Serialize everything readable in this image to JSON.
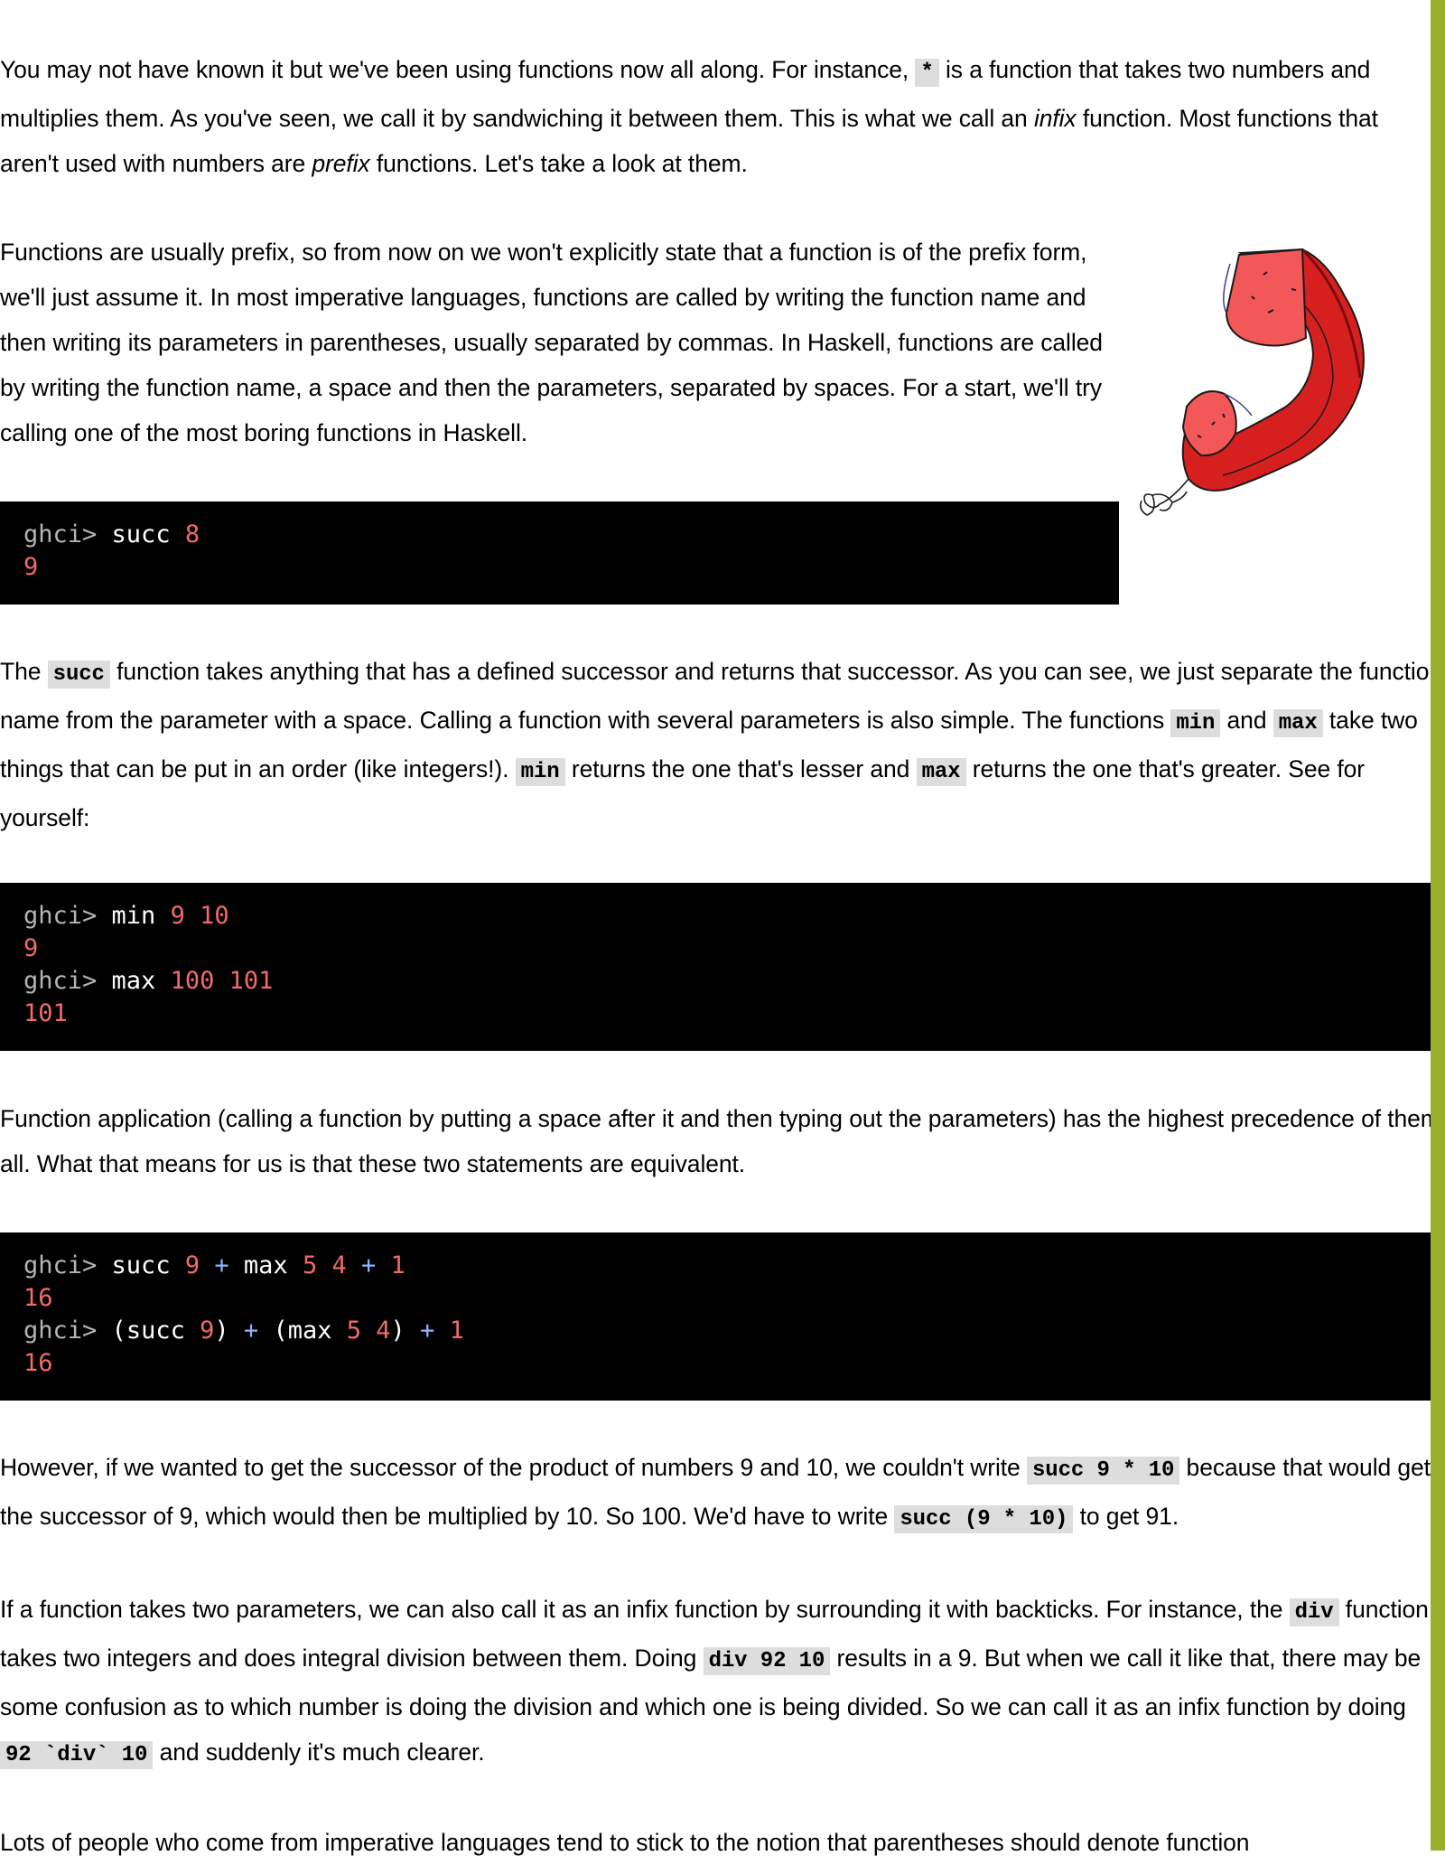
{
  "p1": {
    "t1": "You may not have known it but we've been using functions now all along. For instance, ",
    "c1": "*",
    "t2": " is a function that takes two numbers and multiplies them. As you've seen, we call it by sandwiching it between them. This is what we call an ",
    "e1": "infix",
    "t3": " function. Most functions that aren't used with numbers are ",
    "e2": "prefix",
    "t4": " functions. Let's take a look at them."
  },
  "p2": {
    "text": "Functions are usually prefix, so from now on we won't explicitly state that a function is of the prefix form, we'll just assume it. In most imperative languages, functions are called by writing the function name and then writing its parameters in parentheses, usually separated by commas. In Haskell, functions are called by writing the function name, a space and then the parameters, separated by spaces. For a start, we'll try calling one of the most boring functions in Haskell."
  },
  "code1": {
    "prompt": "ghci>",
    "fn": "succ",
    "arg": "8",
    "output": "9"
  },
  "p3": {
    "t1": "The ",
    "c1": "succ",
    "t2": " function takes anything that has a defined successor and returns that successor. As you can see, we just separate the function name from the parameter with a space. Calling a function with several parameters is also simple. The functions ",
    "c2": "min",
    "t3": " and ",
    "c3": "max",
    "t4": " take two things that can be put in an order (like integers!). ",
    "c4": "min",
    "t5": " returns the one that's lesser and ",
    "c5": "max",
    "t6": " returns the one that's greater. See for yourself:"
  },
  "code2": {
    "prompt": "ghci>",
    "l1_fn": "min",
    "l1_a": "9",
    "l1_b": "10",
    "l1_out": "9",
    "l2_fn": "max",
    "l2_a": "100",
    "l2_b": "101",
    "l2_out": "101"
  },
  "p4": {
    "text": "Function application (calling a function by putting a space after it and then typing out the parameters) has the highest precedence of them all. What that means for us is that these two statements are equivalent."
  },
  "code3": {
    "prompt": "ghci>",
    "succ": "succ",
    "max": "max",
    "plus": "+",
    "lp": "(",
    "rp": ")",
    "n9": "9",
    "n5": "5",
    "n4": "4",
    "n1": "1",
    "out": "16"
  },
  "p5": {
    "t1": "However, if we wanted to get the successor of the product of numbers 9 and 10, we couldn't write ",
    "c1": "succ 9 * 10",
    "t2": " because that would get the successor of 9, which would then be multiplied by 10. So 100. We'd have to write ",
    "c2": "succ (9 * 10)",
    "t3": " to get 91."
  },
  "p6": {
    "t1": "If a function takes two parameters, we can also call it as an infix function by surrounding it with backticks. For instance, the ",
    "c1": "div",
    "t2": " function takes two integers and does integral division between them. Doing ",
    "c2": "div 92 10",
    "t3": " results in a 9. But when we call it like that, there may be some confusion as to which number is doing the division and which one is being divided. So we can call it as an infix function by doing ",
    "c3": "92 `div` 10",
    "t4": " and suddenly it's much clearer."
  },
  "p7": {
    "text": "Lots of people who come from imperative languages tend to stick to the notion that parentheses should denote function"
  }
}
